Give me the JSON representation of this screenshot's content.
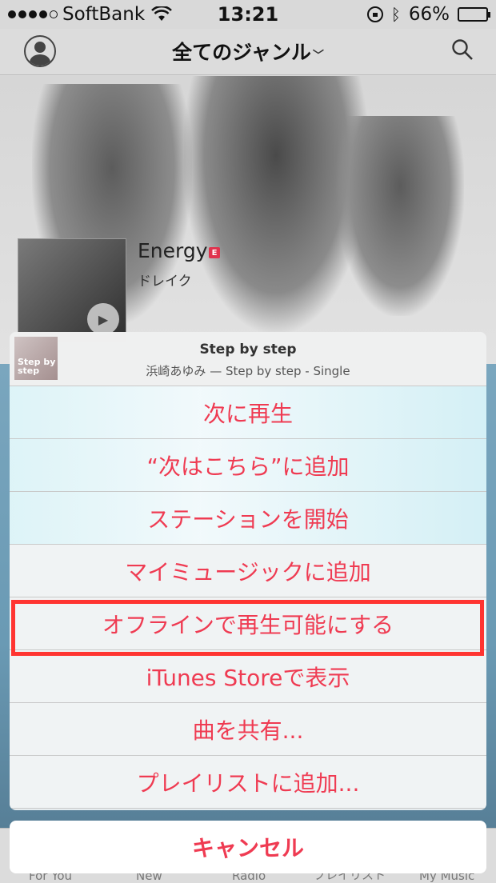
{
  "status_bar": {
    "carrier": "SoftBank",
    "time": "13:21",
    "battery_pct": "66%",
    "battery_level": 0.66,
    "signal_bars": 4
  },
  "nav": {
    "title": "全てのジャンル",
    "chevron": "﹀"
  },
  "hero": {
    "song_title": "Energy",
    "explicit": "E",
    "artist": "ドレイク"
  },
  "sheet": {
    "header": {
      "title": "Step by step",
      "subtitle": "浜崎あゆみ — Step by step - Single",
      "art_text": "Step by step"
    },
    "items": [
      "次に再生",
      "“次はこちら”に追加",
      "ステーションを開始",
      "マイミュージックに追加",
      "オフラインで再生可能にする",
      "iTunes Storeで表示",
      "曲を共有...",
      "プレイリストに追加..."
    ],
    "cancel": "キャンセル"
  },
  "tabs": [
    "For You",
    "New",
    "Radio",
    "プレイリスト",
    "My Music"
  ],
  "colors": {
    "accent": "#ef3b52",
    "highlight": "#ff3431"
  }
}
